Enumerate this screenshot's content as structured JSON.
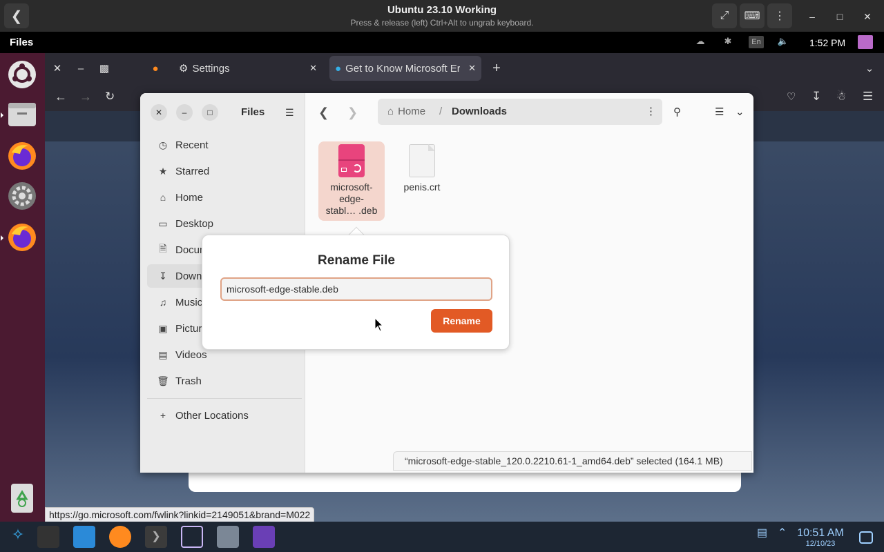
{
  "viewer": {
    "title": "Ubuntu 23.10 Working",
    "subtitle": "Press & release (left) Ctrl+Alt to ungrab keyboard."
  },
  "top_panel": {
    "activities": "Files",
    "lang": "En",
    "clock": "1:52 PM"
  },
  "browser": {
    "tabs": [
      {
        "label": "Settings"
      },
      {
        "label": "Get to Know Microsoft Er"
      }
    ],
    "status_link": "https://go.microsoft.com/fwlink?linkid=2149051&brand=M022"
  },
  "files": {
    "sidebar_title": "Files",
    "sidebar_items": [
      {
        "label": "Recent",
        "icon": "clock-icon"
      },
      {
        "label": "Starred",
        "icon": "star-icon"
      },
      {
        "label": "Home",
        "icon": "home-icon"
      },
      {
        "label": "Desktop",
        "icon": "desktop-icon"
      },
      {
        "label": "Docum",
        "icon": "document-icon"
      },
      {
        "label": "Downl",
        "icon": "download-icon"
      },
      {
        "label": "Music",
        "icon": "music-icon"
      },
      {
        "label": "Pictur",
        "icon": "picture-icon"
      },
      {
        "label": "Videos",
        "icon": "video-icon"
      },
      {
        "label": "Trash",
        "icon": "trash-icon"
      },
      {
        "label": "Other Locations",
        "icon": "plus-icon"
      }
    ],
    "path": {
      "home": "Home",
      "separator": "/",
      "current": "Downloads"
    },
    "items": [
      {
        "line1": "microsoft-",
        "line2": "edge-",
        "line3": "stabl… .deb",
        "selected": true
      },
      {
        "line1": "penis.crt",
        "selected": false
      }
    ],
    "status": "“microsoft-edge-stable_120.0.2210.61-1_amd64.deb” selected  (164.1 MB)"
  },
  "rename_dialog": {
    "title": "Rename File",
    "value": "microsoft-edge-stable.deb",
    "button": "Rename"
  },
  "taskbar": {
    "time": "10:51 AM",
    "date": "12/10/23"
  },
  "colors": {
    "accent": "#e25a25",
    "dock": "#4b1a31",
    "selection": "#f4d6cd"
  }
}
